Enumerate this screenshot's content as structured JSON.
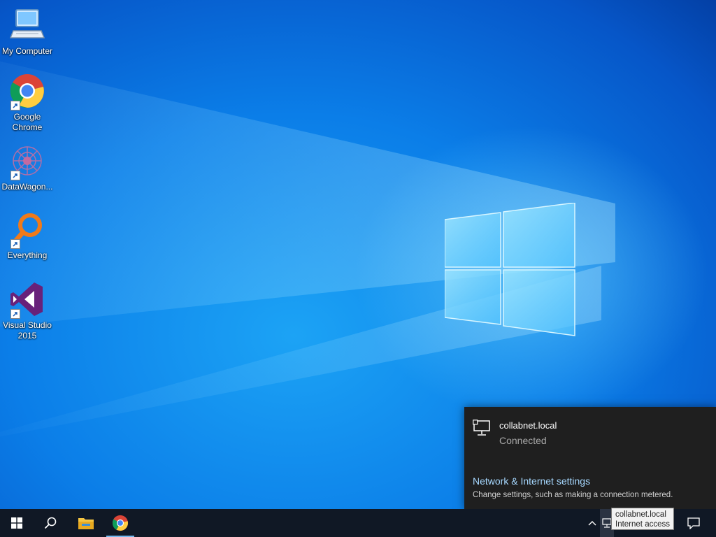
{
  "desktop_icons": [
    {
      "label": "My Computer",
      "icon": "computer-icon"
    },
    {
      "label": "Google\nChrome",
      "icon": "chrome-icon"
    },
    {
      "label": "DataWagon...",
      "icon": "datawagon-icon"
    },
    {
      "label": "Everything",
      "icon": "magnifier-icon"
    },
    {
      "label": "Visual Studio\n2015",
      "icon": "visual-studio-icon"
    }
  ],
  "network_flyout": {
    "network_name": "collabnet.local",
    "status": "Connected",
    "settings_link": "Network & Internet settings",
    "settings_description": "Change settings, such as making a connection metered."
  },
  "taskbar": {
    "start_icon": "windows-logo-icon",
    "search_icon": "search-icon",
    "pinned": [
      "file-explorer-icon",
      "chrome-icon"
    ],
    "tray_chevron": "chevron-up-icon",
    "network_tray_icon": "network-icon",
    "action_center_icon": "notification-icon"
  },
  "tooltip": {
    "line1": "collabnet.local",
    "line2": "Internet access"
  },
  "colors": {
    "taskbar": "#101825",
    "flyout_bg": "#1f1f1f",
    "link": "#a6d8ff",
    "wallpaper_blue": "#0b7ee8"
  }
}
